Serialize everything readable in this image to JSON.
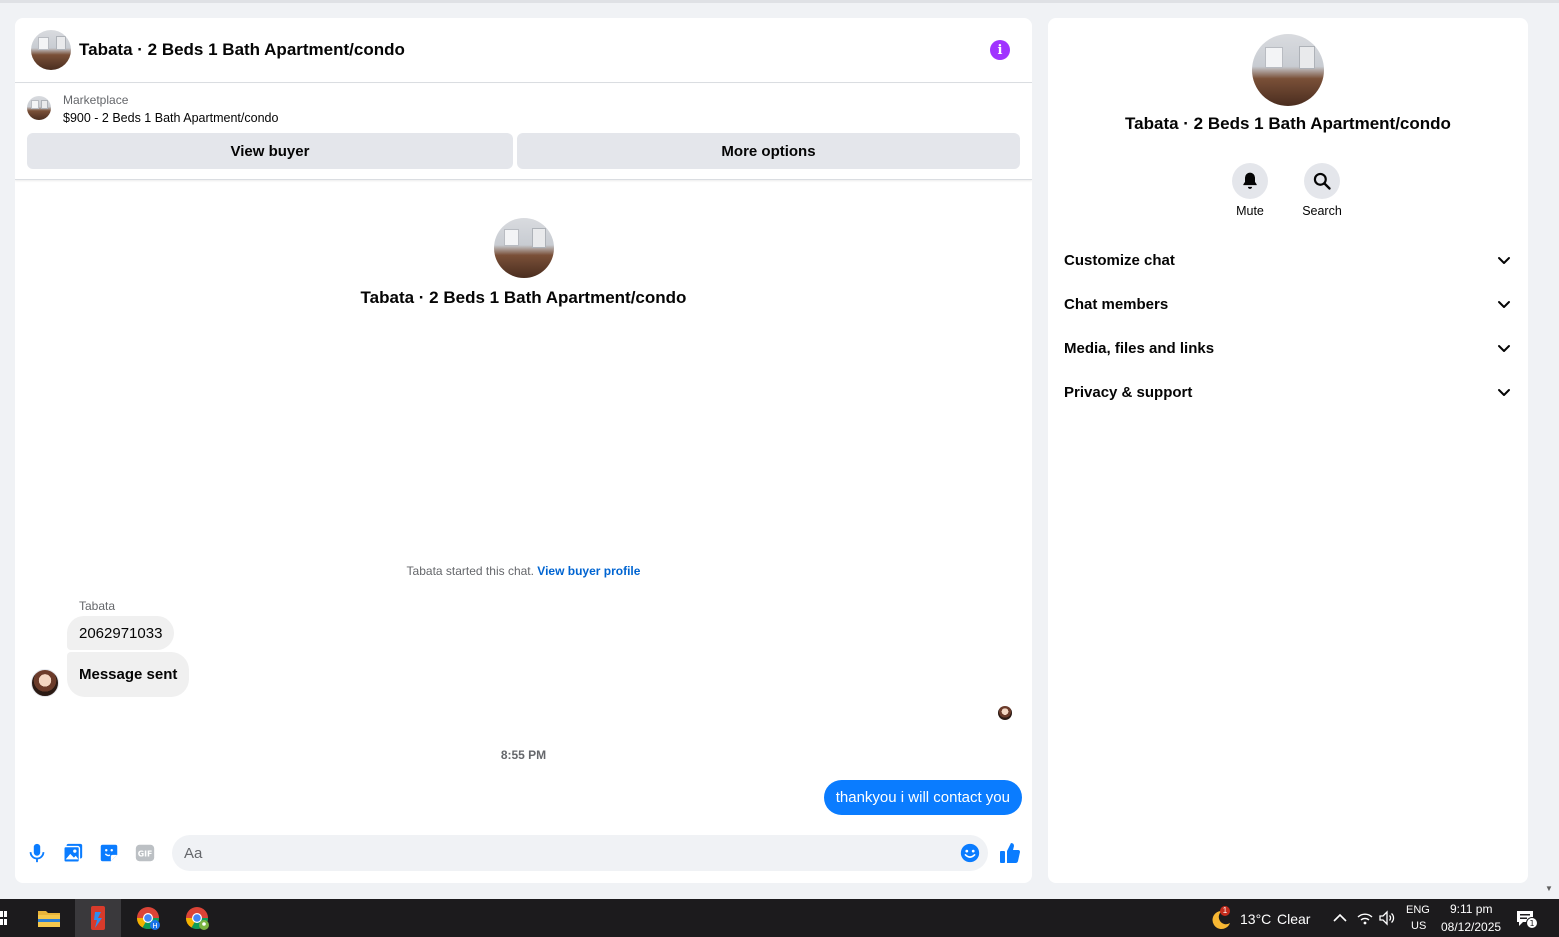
{
  "chat": {
    "title": "Tabata · 2 Beds 1 Bath Apartment/condo",
    "info_icon": "i",
    "marketplace": {
      "label": "Marketplace",
      "listing": "$900 - 2 Beds 1 Bath Apartment/condo"
    },
    "buttons": {
      "view_buyer": "View buyer",
      "more_options": "More options"
    },
    "intro_title": "Tabata · 2 Beds 1 Bath Apartment/condo",
    "started_note": "Tabata started this chat. ",
    "started_link": "View buyer profile",
    "sender_name": "Tabata",
    "messages_in": [
      "2062971033",
      "Message sent"
    ],
    "timestamp": "8:55 PM",
    "message_out": "thankyou i will contact you",
    "composer_placeholder": "Aa"
  },
  "info": {
    "title": "Tabata · 2 Beds 1 Bath Apartment/condo",
    "actions": {
      "mute": "Mute",
      "search": "Search"
    },
    "sections": [
      "Customize chat",
      "Chat members",
      "Media, files and links",
      "Privacy & support"
    ]
  },
  "taskbar": {
    "weather_badge": "1",
    "temperature": "13°C",
    "condition": "Clear",
    "lang_line1": "ENG",
    "lang_line2": "US",
    "time": "9:11 pm",
    "date": "08/12/2025",
    "notification_count": "1"
  },
  "colors": {
    "accent_blue": "#0a7cff",
    "link_blue": "#0064d1",
    "info_purple": "#a033ff",
    "bubble_gray": "#f0f0f0"
  },
  "icons": [
    "info-icon",
    "mic-icon",
    "photo-icon",
    "sticker-icon",
    "gif-icon",
    "emoji-icon",
    "like-icon",
    "bell-icon",
    "search-icon",
    "chevron-down-icon"
  ]
}
